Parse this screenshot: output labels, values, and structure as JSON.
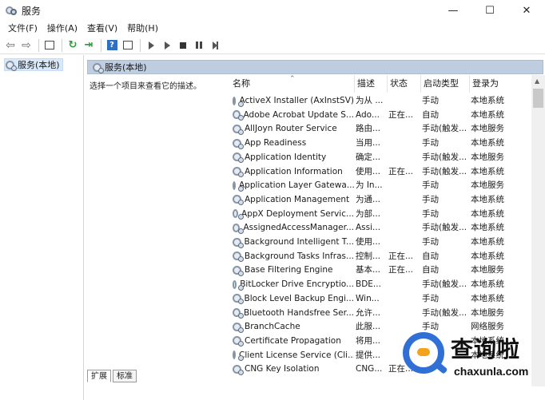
{
  "window": {
    "title": "服务",
    "minimize": "—",
    "maximize": "☐",
    "close": "✕"
  },
  "menu": [
    "文件(F)",
    "操作(A)",
    "查看(V)",
    "帮助(H)"
  ],
  "tree": {
    "root": "服务(本地)"
  },
  "content": {
    "header": "服务(本地)",
    "description": "选择一个项目来查看它的描述。"
  },
  "columns": {
    "name": "名称",
    "desc": "描述",
    "status": "状态",
    "startup": "启动类型",
    "logon": "登录为"
  },
  "services": [
    {
      "name": "ActiveX Installer (AxInstSV)",
      "desc": "为从 ...",
      "status": "",
      "startup": "手动",
      "logon": "本地系统"
    },
    {
      "name": "Adobe Acrobat Update S...",
      "desc": "Ado...",
      "status": "正在...",
      "startup": "自动",
      "logon": "本地系统"
    },
    {
      "name": "AllJoyn Router Service",
      "desc": "路由...",
      "status": "",
      "startup": "手动(触发...",
      "logon": "本地服务"
    },
    {
      "name": "App Readiness",
      "desc": "当用...",
      "status": "",
      "startup": "手动",
      "logon": "本地系统"
    },
    {
      "name": "Application Identity",
      "desc": "确定...",
      "status": "",
      "startup": "手动(触发...",
      "logon": "本地服务"
    },
    {
      "name": "Application Information",
      "desc": "使用...",
      "status": "正在...",
      "startup": "手动(触发...",
      "logon": "本地系统"
    },
    {
      "name": "Application Layer Gatewa...",
      "desc": "为 In...",
      "status": "",
      "startup": "手动",
      "logon": "本地服务"
    },
    {
      "name": "Application Management",
      "desc": "为通...",
      "status": "",
      "startup": "手动",
      "logon": "本地系统"
    },
    {
      "name": "AppX Deployment Servic...",
      "desc": "为部...",
      "status": "",
      "startup": "手动",
      "logon": "本地系统"
    },
    {
      "name": "AssignedAccessManager...",
      "desc": "Assi...",
      "status": "",
      "startup": "手动(触发...",
      "logon": "本地系统"
    },
    {
      "name": "Background Intelligent T...",
      "desc": "使用...",
      "status": "",
      "startup": "手动",
      "logon": "本地系统"
    },
    {
      "name": "Background Tasks Infras...",
      "desc": "控制...",
      "status": "正在...",
      "startup": "自动",
      "logon": "本地系统"
    },
    {
      "name": "Base Filtering Engine",
      "desc": "基本...",
      "status": "正在...",
      "startup": "自动",
      "logon": "本地服务"
    },
    {
      "name": "BitLocker Drive Encryptio...",
      "desc": "BDE...",
      "status": "",
      "startup": "手动(触发...",
      "logon": "本地系统"
    },
    {
      "name": "Block Level Backup Engi...",
      "desc": "Win...",
      "status": "",
      "startup": "手动",
      "logon": "本地系统"
    },
    {
      "name": "Bluetooth Handsfree Ser...",
      "desc": "允许...",
      "status": "",
      "startup": "手动(触发...",
      "logon": "本地服务"
    },
    {
      "name": "BranchCache",
      "desc": "此服...",
      "status": "",
      "startup": "手动",
      "logon": "网络服务"
    },
    {
      "name": "Certificate Propagation",
      "desc": "将用...",
      "status": "",
      "startup": "手动",
      "logon": "本地系统"
    },
    {
      "name": "Client License Service (Cli...",
      "desc": "提供...",
      "status": "",
      "startup": "手动",
      "logon": "本地系统"
    },
    {
      "name": "CNG Key Isolation",
      "desc": "CNG...",
      "status": "正在...",
      "startup": "",
      "logon": ""
    }
  ],
  "tabs": [
    "扩展",
    "标准"
  ],
  "watermark": {
    "text": "查询啦",
    "url": "chaxunla.com"
  },
  "colors": {
    "header_bg": "#bfcde0",
    "selection_bg": "#d9e9f9",
    "watermark_blue": "#2f6fd6",
    "watermark_orange": "#f3a21b"
  }
}
